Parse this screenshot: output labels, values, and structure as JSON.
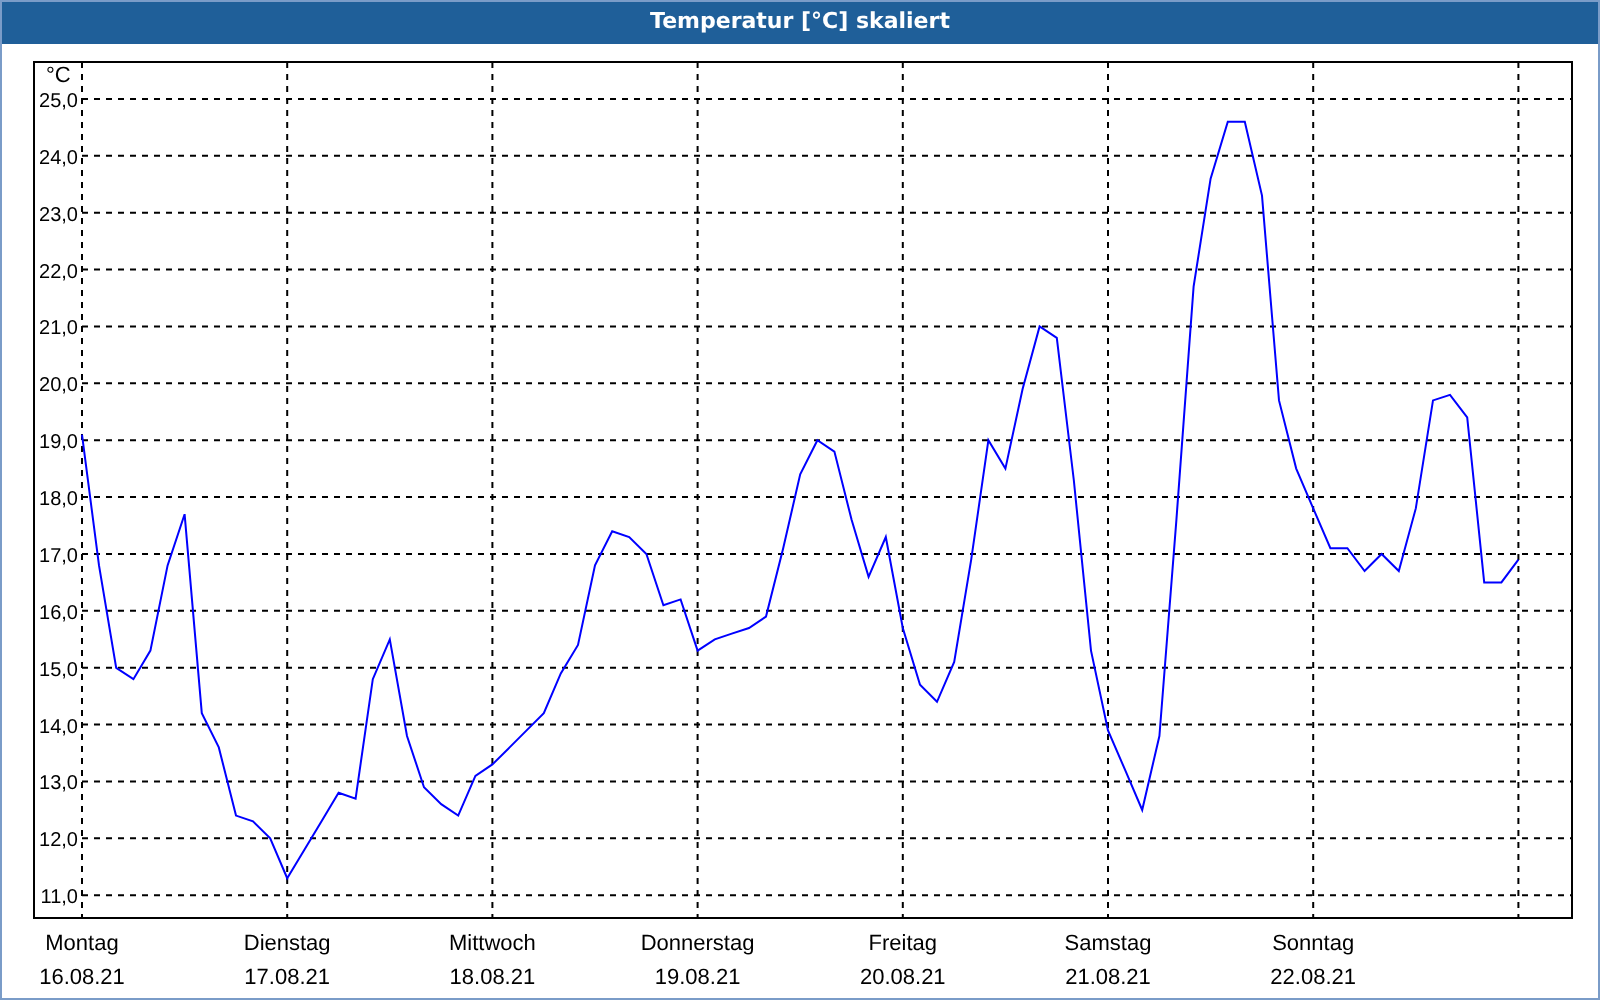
{
  "chart": {
    "chart_data": {
      "type": "line",
      "title": "Temperatur [°C] skaliert",
      "ylabel": "°C",
      "ylim": [
        10.6,
        25.65
      ],
      "grid": true,
      "categories": [
        "Montag",
        null,
        null,
        null,
        null,
        null,
        null,
        null,
        null,
        null,
        null,
        null,
        "Dienstag",
        null,
        null,
        null,
        null,
        null,
        null,
        null,
        null,
        null,
        null,
        null,
        "Mittwoch",
        null,
        null,
        null,
        null,
        null,
        null,
        null,
        null,
        null,
        null,
        null,
        "Donnerstag",
        null,
        null,
        null,
        null,
        null,
        null,
        null,
        null,
        null,
        null,
        null,
        "Freitag",
        null,
        null,
        null,
        null,
        null,
        null,
        null,
        null,
        null,
        null,
        null,
        "Samstag",
        null,
        null,
        null,
        null,
        null,
        null,
        null,
        null,
        null,
        null,
        null,
        "Sonntag",
        null,
        null,
        null,
        null,
        null,
        null,
        null,
        null,
        null,
        null,
        null,
        null
      ],
      "yticks": [
        {
          "value": 11,
          "label": "11,0"
        },
        {
          "value": 12,
          "label": "12,0"
        },
        {
          "value": 13,
          "label": "13,0"
        },
        {
          "value": 14,
          "label": "14,0"
        },
        {
          "value": 15,
          "label": "15,0"
        },
        {
          "value": 16,
          "label": "16,0"
        },
        {
          "value": 17,
          "label": "17,0"
        },
        {
          "value": 18,
          "label": "18,0"
        },
        {
          "value": 19,
          "label": "19,0"
        },
        {
          "value": 20,
          "label": "20,0"
        },
        {
          "value": 21,
          "label": "21,0"
        },
        {
          "value": 22,
          "label": "22,0"
        },
        {
          "value": 23,
          "label": "23,0"
        },
        {
          "value": 24,
          "label": "24,0"
        },
        {
          "value": 25,
          "label": "25,0"
        }
      ],
      "series": [
        {
          "color": "#0000ff",
          "values": [
            19.1,
            16.8,
            15.0,
            14.8,
            15.3,
            16.8,
            17.7,
            14.2,
            13.6,
            12.4,
            12.3,
            12.0,
            11.3,
            11.8,
            12.3,
            12.8,
            12.7,
            14.8,
            15.5,
            13.8,
            12.9,
            12.6,
            12.4,
            13.1,
            13.3,
            13.6,
            13.9,
            14.2,
            14.9,
            15.4,
            16.8,
            17.4,
            17.3,
            17.0,
            16.1,
            16.2,
            15.3,
            15.5,
            15.6,
            15.7,
            15.9,
            17.1,
            18.4,
            19.0,
            18.8,
            17.6,
            16.6,
            17.3,
            15.7,
            14.7,
            14.4,
            15.1,
            16.9,
            19.0,
            18.5,
            19.9,
            21.0,
            20.8,
            18.3,
            15.3,
            13.9,
            13.2,
            12.5,
            13.8,
            17.6,
            21.7,
            23.6,
            24.6,
            24.6,
            23.3,
            19.7,
            18.5,
            17.8,
            17.1,
            17.1,
            16.7,
            17.0,
            16.7,
            17.8,
            19.7,
            19.8,
            19.4,
            16.5,
            16.5,
            16.9
          ]
        }
      ]
    },
    "date_labels": [
      "16.08.21",
      "17.08.21",
      "18.08.21",
      "19.08.21",
      "20.08.21",
      "21.08.21",
      "22.08.21"
    ]
  }
}
